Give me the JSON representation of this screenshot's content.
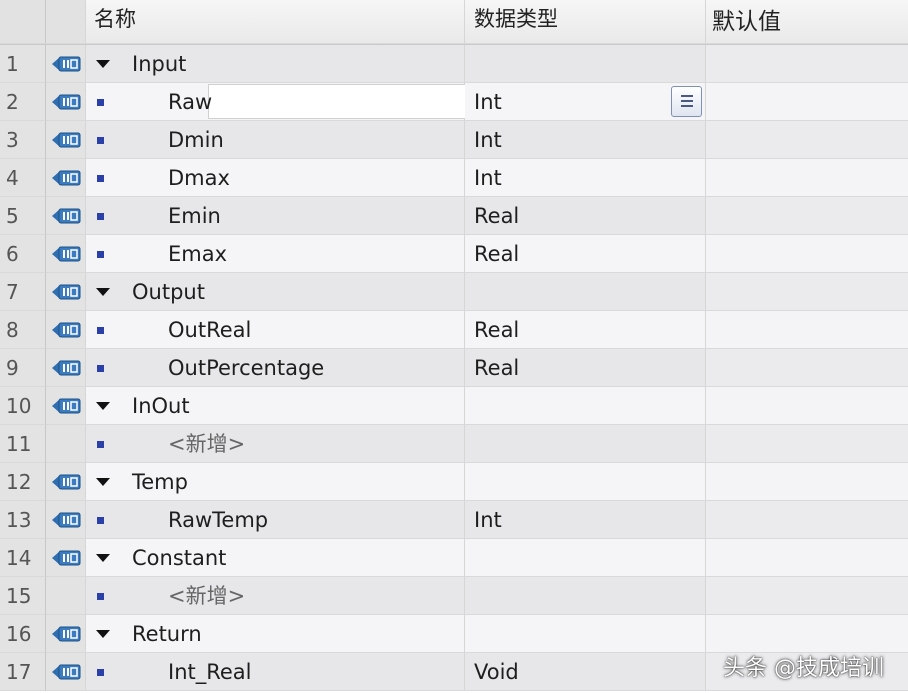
{
  "header": {
    "name": "名称",
    "datatype": "数据类型",
    "default": "默认值"
  },
  "rows": [
    {
      "no": "1",
      "kind": "section",
      "name": "Input",
      "type": ""
    },
    {
      "no": "2",
      "kind": "variable",
      "name": "Raw",
      "type": "Int"
    },
    {
      "no": "3",
      "kind": "variable",
      "name": "Dmin",
      "type": "Int"
    },
    {
      "no": "4",
      "kind": "variable",
      "name": "Dmax",
      "type": "Int"
    },
    {
      "no": "5",
      "kind": "variable",
      "name": "Emin",
      "type": "Real"
    },
    {
      "no": "6",
      "kind": "variable",
      "name": "Emax",
      "type": "Real"
    },
    {
      "no": "7",
      "kind": "section",
      "name": "Output",
      "type": ""
    },
    {
      "no": "8",
      "kind": "variable",
      "name": "OutReal",
      "type": "Real"
    },
    {
      "no": "9",
      "kind": "variable",
      "name": "OutPercentage",
      "type": "Real"
    },
    {
      "no": "10",
      "kind": "section",
      "name": "InOut",
      "type": ""
    },
    {
      "no": "11",
      "kind": "add",
      "name": "<新增>",
      "type": ""
    },
    {
      "no": "12",
      "kind": "section",
      "name": "Temp",
      "type": ""
    },
    {
      "no": "13",
      "kind": "variable",
      "name": "RawTemp",
      "type": "Int"
    },
    {
      "no": "14",
      "kind": "section",
      "name": "Constant",
      "type": ""
    },
    {
      "no": "15",
      "kind": "add",
      "name": "<新增>",
      "type": ""
    },
    {
      "no": "16",
      "kind": "section",
      "name": "Return",
      "type": ""
    },
    {
      "no": "17",
      "kind": "variable",
      "name": "Int_Real",
      "type": "Void"
    }
  ],
  "icons": {
    "section_row": "expand-triangle-icon",
    "variable_row": "variable-square-icon",
    "interface": "interface-io-icon",
    "type_list": "type-list-icon"
  },
  "colors": {
    "square": "#2a3fa8",
    "io_icon": "#2f6fb0"
  },
  "watermark": "头条 @技成培训"
}
